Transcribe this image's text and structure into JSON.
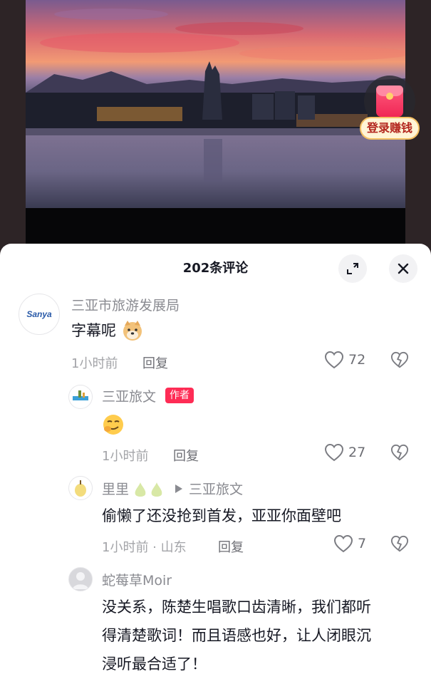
{
  "video": {
    "reward_label": "登录赚钱"
  },
  "comments_panel": {
    "title": "202条评论",
    "icons": {
      "expand": "expand-icon",
      "close": "close-icon"
    },
    "comments": [
      {
        "user": "三亚市旅游发展局",
        "avatar_text": "Sanya",
        "text": "字幕呢",
        "emoji": "doge-emoji",
        "time": "1小时前",
        "reply": "回复",
        "likes": "72"
      },
      {
        "user": "三亚旅文",
        "badge": "作者",
        "emoji": "smirk-emoji",
        "time": "1小时前",
        "reply": "回复",
        "likes": "27"
      },
      {
        "user": "里里",
        "reply_to": "三亚旅文",
        "text": "偷懒了还没抢到首发，亚亚你面壁吧",
        "time": "1小时前 · 山东",
        "reply": "回复",
        "likes": "7"
      },
      {
        "user": "蛇莓草Moir",
        "text_lines": [
          "没关系，陈楚生唱歌口齿清晰，我们都听",
          "得清楚歌词！而且语感也好，让人闭眼沉",
          "浸听最合适了！"
        ]
      }
    ]
  },
  "colors": {
    "accent": "#fe2c55",
    "muted_text": "#8a8b91",
    "primary_text": "#161823"
  }
}
